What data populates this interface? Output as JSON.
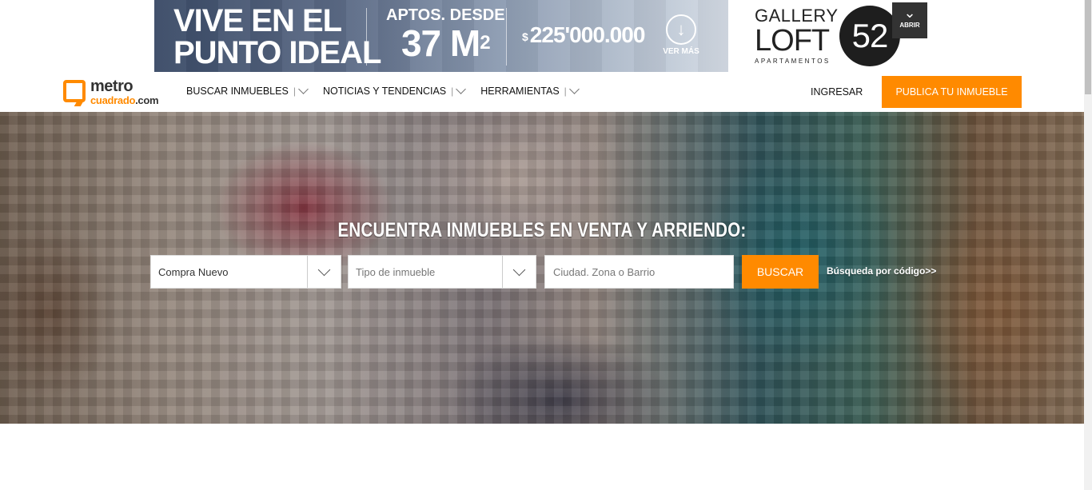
{
  "ad": {
    "headline_line1": "VIVE EN EL",
    "headline_line2": "PUNTO IDEAL",
    "aptos_label": "APTOS. DESDE",
    "aptos_value": "37 M",
    "aptos_sup": "2",
    "price_currency": "$",
    "price_value": "225'000.000",
    "ver_mas_label": "VER MÁS"
  },
  "brand_ad": {
    "line1": "GALLERY",
    "line2": "LOFT",
    "line3": "APARTAMENTOS",
    "number": "52",
    "abrir_label": "ABRIR"
  },
  "logo": {
    "line1": "metro",
    "line2_main": "cuadrado",
    "line2_suffix": ".com"
  },
  "nav": {
    "items": [
      {
        "label": "BUSCAR INMUEBLES"
      },
      {
        "label": "NOTICIAS Y TENDENCIAS"
      },
      {
        "label": "HERRAMIENTAS"
      }
    ],
    "login_label": "INGRESAR",
    "publish_label": "PUBLICA TU INMUEBLE"
  },
  "search": {
    "title": "ENCUENTRA INMUEBLES EN VENTA Y ARRIENDO:",
    "operation_value": "Compra Nuevo",
    "property_type_placeholder": "Tipo de inmueble",
    "location_placeholder": "Ciudad. Zona o Barrio",
    "search_button": "BUSCAR",
    "code_search_link": "Búsqueda por código>>"
  },
  "colors": {
    "accent": "#ff8a00",
    "text_dark": "#111111"
  }
}
